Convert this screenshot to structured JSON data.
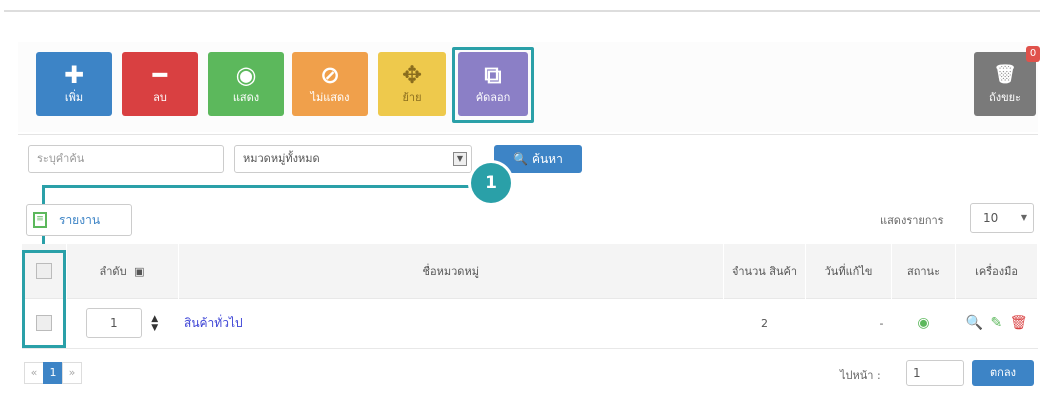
{
  "toolbar": {
    "add": {
      "glyph": "✚",
      "label": "เพิ่ม"
    },
    "delete": {
      "glyph": "━",
      "label": "ลบ"
    },
    "show": {
      "glyph": "◉",
      "label": "แสดง"
    },
    "hide": {
      "glyph": "⊘",
      "label": "ไม่แสดง"
    },
    "move": {
      "glyph": "✥",
      "label": "ย้าย"
    },
    "copy": {
      "glyph": "⧉",
      "label": "คัดลอก"
    },
    "trash": {
      "glyph": "🗑",
      "label": "ถังขยะ",
      "badge": "0"
    }
  },
  "search": {
    "placeholder": "ระบุคำค้น",
    "category_selected": "หมวดหมู่ทั้งหมด",
    "button_label": "ค้นหา"
  },
  "callout": {
    "number": "1"
  },
  "report_button": "รายงาน",
  "page_size": {
    "label": "แสดงรายการ",
    "value": "10"
  },
  "table": {
    "headers": {
      "order": "ลำดับ",
      "name": "ชื่อหมวดหมู่",
      "count": "จำนวน สินค้า",
      "updated": "วันที่แก้ไข",
      "status": "สถานะ",
      "tools": "เครื่องมือ"
    },
    "rows": [
      {
        "order": "1",
        "name": "สินค้าทั่วไป",
        "count": "2",
        "updated": "-"
      }
    ]
  },
  "pagination": {
    "prev": "«",
    "current": "1",
    "next": "»",
    "goto_label": "ไปหน้า :",
    "goto_value": "1",
    "go_button": "ตกลง"
  },
  "colors": {
    "accent": "#3d84c6",
    "highlight": "#2aa0a8"
  }
}
